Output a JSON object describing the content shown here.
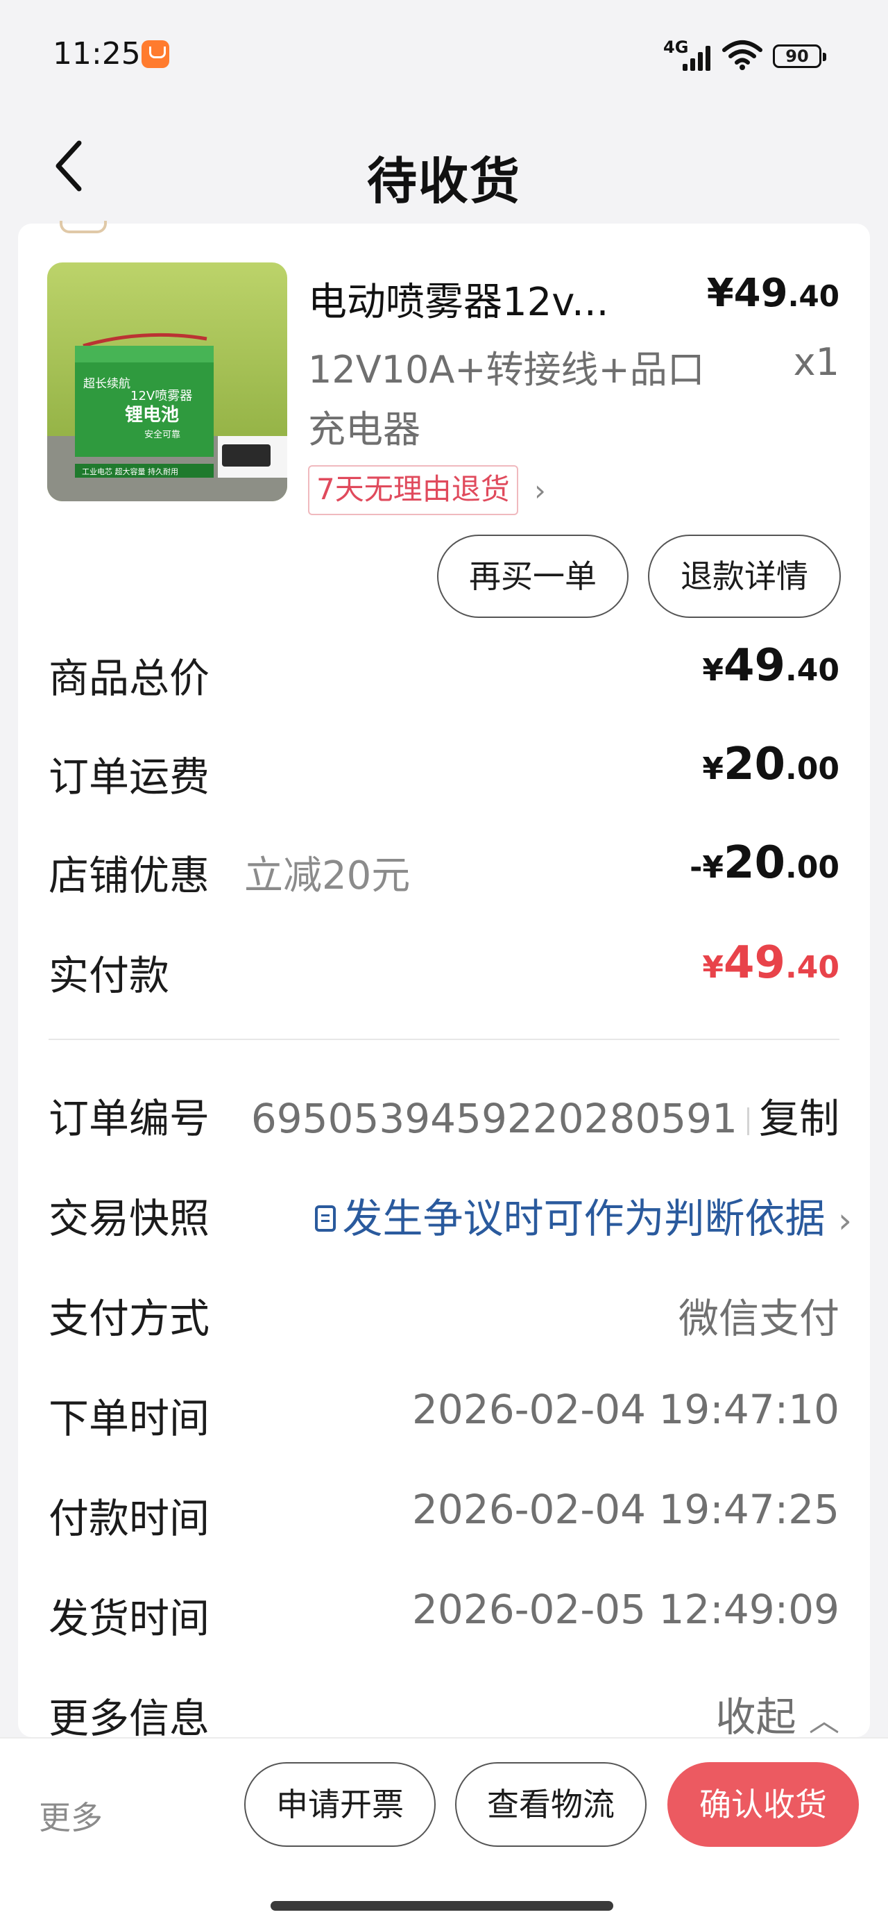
{
  "status_bar": {
    "time": "11:25",
    "network": "4G",
    "battery": "90"
  },
  "header": {
    "title": "待收货"
  },
  "product": {
    "name": "电动喷雾器12v...",
    "price_whole": "¥49",
    "price_decimal": ".40",
    "spec": "12V10A+转接线+品口充电器",
    "qty": "x1",
    "return_tag": "7天无理由退货",
    "image_texts": [
      "超长续航",
      "12V喷雾器",
      "锂电池",
      "安全可靠",
      "工业电芯 超大容量 持久耐用"
    ]
  },
  "order_actions": {
    "rebuy": "再买一单",
    "refund_detail": "退款详情"
  },
  "price_summary": {
    "goods_total": {
      "label": "商品总价",
      "cur": "¥",
      "whole": "49",
      "dec": ".40"
    },
    "shipping": {
      "label": "订单运费",
      "cur": "¥",
      "whole": "20",
      "dec": ".00"
    },
    "discount": {
      "label": "店铺优惠",
      "note": "立减20元",
      "cur": "-¥",
      "whole": "20",
      "dec": ".00"
    },
    "paid": {
      "label": "实付款",
      "cur": "¥",
      "whole": "49",
      "dec": ".40"
    }
  },
  "order_info": {
    "order_no_label": "订单编号",
    "order_no": "6950539459220280591",
    "copy": "复制",
    "snapshot_label": "交易快照",
    "snapshot_text": "发生争议时可作为判断依据",
    "payment_label": "支付方式",
    "payment": "微信支付",
    "order_time_label": "下单时间",
    "order_time": "2026-02-04 19:47:10",
    "pay_time_label": "付款时间",
    "pay_time": "2026-02-04 19:47:25",
    "ship_time_label": "发货时间",
    "ship_time": "2026-02-05 12:49:09",
    "more_info_label": "更多信息",
    "collapse": "收起"
  },
  "bottom_bar": {
    "more": "更多",
    "invoice": "申请开票",
    "logistics": "查看物流",
    "confirm": "确认收货"
  },
  "colors": {
    "accent_red": "#e8434a",
    "confirm_button": "#ec5a61",
    "link_blue": "#2a5a9d",
    "background": "#f3f3f5"
  }
}
